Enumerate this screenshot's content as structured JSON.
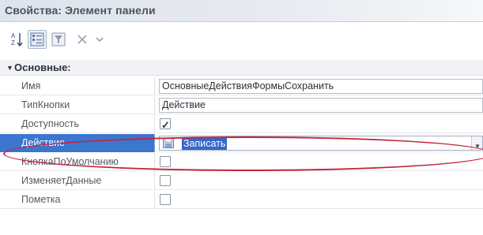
{
  "window": {
    "title": "Свойства: Элемент панели"
  },
  "toolbar": {
    "buttons": [
      {
        "name": "sort-az-icon"
      },
      {
        "name": "categorized-view-icon"
      },
      {
        "name": "filter-icon"
      },
      {
        "name": "close-icon"
      },
      {
        "name": "chevron-down-icon"
      }
    ]
  },
  "group": {
    "label": "Основные:"
  },
  "properties": [
    {
      "name": "Имя",
      "type": "text",
      "value": "ОсновныеДействияФормыСохранить"
    },
    {
      "name": "ТипКнопки",
      "type": "text",
      "value": "Действие"
    },
    {
      "name": "Доступность",
      "type": "checkbox",
      "checked": true
    },
    {
      "name": "Действие",
      "type": "select",
      "value": "Записать",
      "selected": true
    },
    {
      "name": "КнопкаПоУмолчанию",
      "type": "checkbox",
      "checked": false
    },
    {
      "name": "ИзменяетДанные",
      "type": "checkbox",
      "checked": false
    },
    {
      "name": "Пометка",
      "type": "checkbox",
      "checked": false
    }
  ],
  "colors": {
    "selection": "#3b76cf",
    "highlight_ellipse": "#c5233b"
  }
}
